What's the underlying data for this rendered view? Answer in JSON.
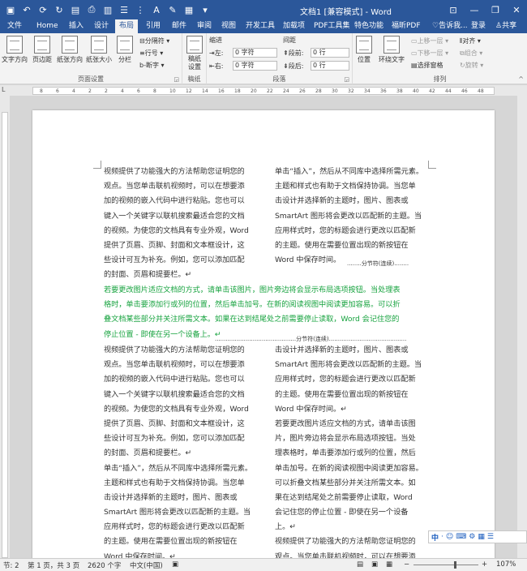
{
  "titlebar": {
    "title": "文档1 [兼容模式] - Word",
    "qat_icons": [
      "save-icon",
      "undo-icon",
      "redo-icon",
      "refresh-icon",
      "open-icon",
      "print-preview-icon",
      "paste-icon",
      "list-icon",
      "format-icon",
      "font-color-icon",
      "highlight-icon",
      "image-icon",
      "customize-icon"
    ]
  },
  "tabs": [
    "文件",
    "Home",
    "插入",
    "设计",
    "布局",
    "引用",
    "邮件",
    "审阅",
    "视图",
    "开发工具",
    "加载项",
    "PDF工具集",
    "特色功能",
    "福昕PDF",
    "告诉我...",
    "登录",
    "共享"
  ],
  "ribbon": {
    "page_setup": {
      "label": "页面设置",
      "buttons": [
        "文字方向",
        "页边距",
        "纸张方向",
        "纸张大小",
        "分栏"
      ],
      "small": [
        "分隔符",
        "行号",
        "断字"
      ]
    },
    "draft": {
      "label": "稿纸",
      "button": "稿纸设置"
    },
    "paragraph": {
      "label": "段落",
      "indent_title": "缩进",
      "spacing_title": "间距",
      "left_label": "左:",
      "right_label": "右:",
      "before_label": "段前:",
      "after_label": "段后:",
      "left_value": "0 字符",
      "right_value": "0 字符",
      "before_value": "0 行",
      "after_value": "0 行"
    },
    "arrange": {
      "label": "排列",
      "buttons": [
        "位置",
        "环绕文字"
      ],
      "small": [
        "上移一层",
        "下移一层",
        "选择窗格",
        "对齐",
        "组合",
        "旋转"
      ]
    }
  },
  "ruler_numbers": [
    "8",
    "6",
    "4",
    "2",
    "2",
    "4",
    "6",
    "8",
    "10",
    "12",
    "14",
    "16",
    "18",
    "20",
    "22",
    "24",
    "26",
    "28",
    "30",
    "32",
    "34",
    "36",
    "38",
    "40",
    "42",
    "44",
    "46",
    "48"
  ],
  "doc": {
    "col1_top": [
      "视频提供了功能强大的方法帮助您证明您的",
      "观点。当您单击联机视频时，可以在想要添",
      "加的视频的嵌入代码中进行粘贴。您也可以",
      "键入一个关键字以联机搜索最适合您的文档",
      "的视频。为使您的文档具有专业外观，Word",
      "提供了页眉、页脚、封面和文本框设计，这",
      "些设计可互为补充。例如，您可以添加匹配",
      "的封面、页眉和提要栏。↵"
    ],
    "col2_top": [
      "单击“插入”，然后从不同库中选择所需元素。",
      "主题和样式也有助于文档保持协调。当您单",
      "击设计并选择新的主题时，图片、图表或",
      "SmartArt 图形将会更改以匹配新的主题。当",
      "应用样式时，您的标题会进行更改以匹配新",
      "的主题。使用在需要位置出现的新按钮在",
      "Word 中保存时间。"
    ],
    "section_break_1": "分节符(连续)",
    "green": [
      "若要更改图片适应文档的方式，请单击该图片，图片旁边将会显示布局选项按钮。当处理表",
      "格时，单击要添加行或列的位置，然后单击加号。在新的阅读视图中阅读更加容易。可以折",
      "叠文档某些部分并关注所需文本。如果在达到结尾处之前需要停止读取，Word 会记住您的",
      "停止位置 - 即使在另一个设备上。↵"
    ],
    "section_break_2": "分节符(连续)",
    "col1_bottom": [
      "视频提供了功能强大的方法帮助您证明您的",
      "观点。当您单击联机视频时，可以在想要添",
      "加的视频的嵌入代码中进行粘贴。您也可以",
      "键入一个关键字以联机搜索最适合您的文档",
      "的视频。为使您的文档具有专业外观，Word",
      "提供了页眉、页脚、封面和文本框设计，这",
      "些设计可互为补充。例如，您可以添加匹配",
      "的封面、页眉和提要栏。↵",
      "单击“插入”，然后从不同库中选择所需元素。",
      "主题和样式也有助于文档保持协调。当您单",
      "击设计并选择新的主题时，图片、图表或",
      "SmartArt 图形将会更改以匹配新的主题。当",
      "应用样式时，您的标题会进行更改以匹配新",
      "的主题。使用在需要位置出现的新按钮在",
      "Word 中保存时间。↵"
    ],
    "col2_bottom": [
      "击设计并选择新的主题时，图片、图表或",
      "SmartArt 图形将会更改以匹配新的主题。当",
      "应用样式时，您的标题会进行更改以匹配新",
      "的主题。使用在需要位置出现的新按钮在",
      "Word 中保存时间。↵",
      "若要更改图片适应文档的方式，请单击该图",
      "片，图片旁边将会显示布局选项按钮。当处",
      "理表格时，单击要添加行或列的位置，然后",
      "单击加号。在新的阅读视图中阅读更加容易。",
      "可以折叠文档某些部分并关注所需文本。如",
      "果在达到结尾处之前需要停止读取，Word",
      "会记住您的停止位置 - 即使在另一个设备",
      "上。↵",
      "视频提供了功能强大的方法帮助您证明您的",
      "观点。当您单击联机视频时，可以在想要添"
    ]
  },
  "ime": {
    "label": "中",
    "items": [
      "·",
      "☺",
      "⌨",
      "⚙"
    ]
  },
  "statusbar": {
    "section": "节: 2",
    "page": "第 1 页，共 3 页",
    "words": "2620 个字",
    "lang": "中文(中国)",
    "zoom": "107%"
  }
}
